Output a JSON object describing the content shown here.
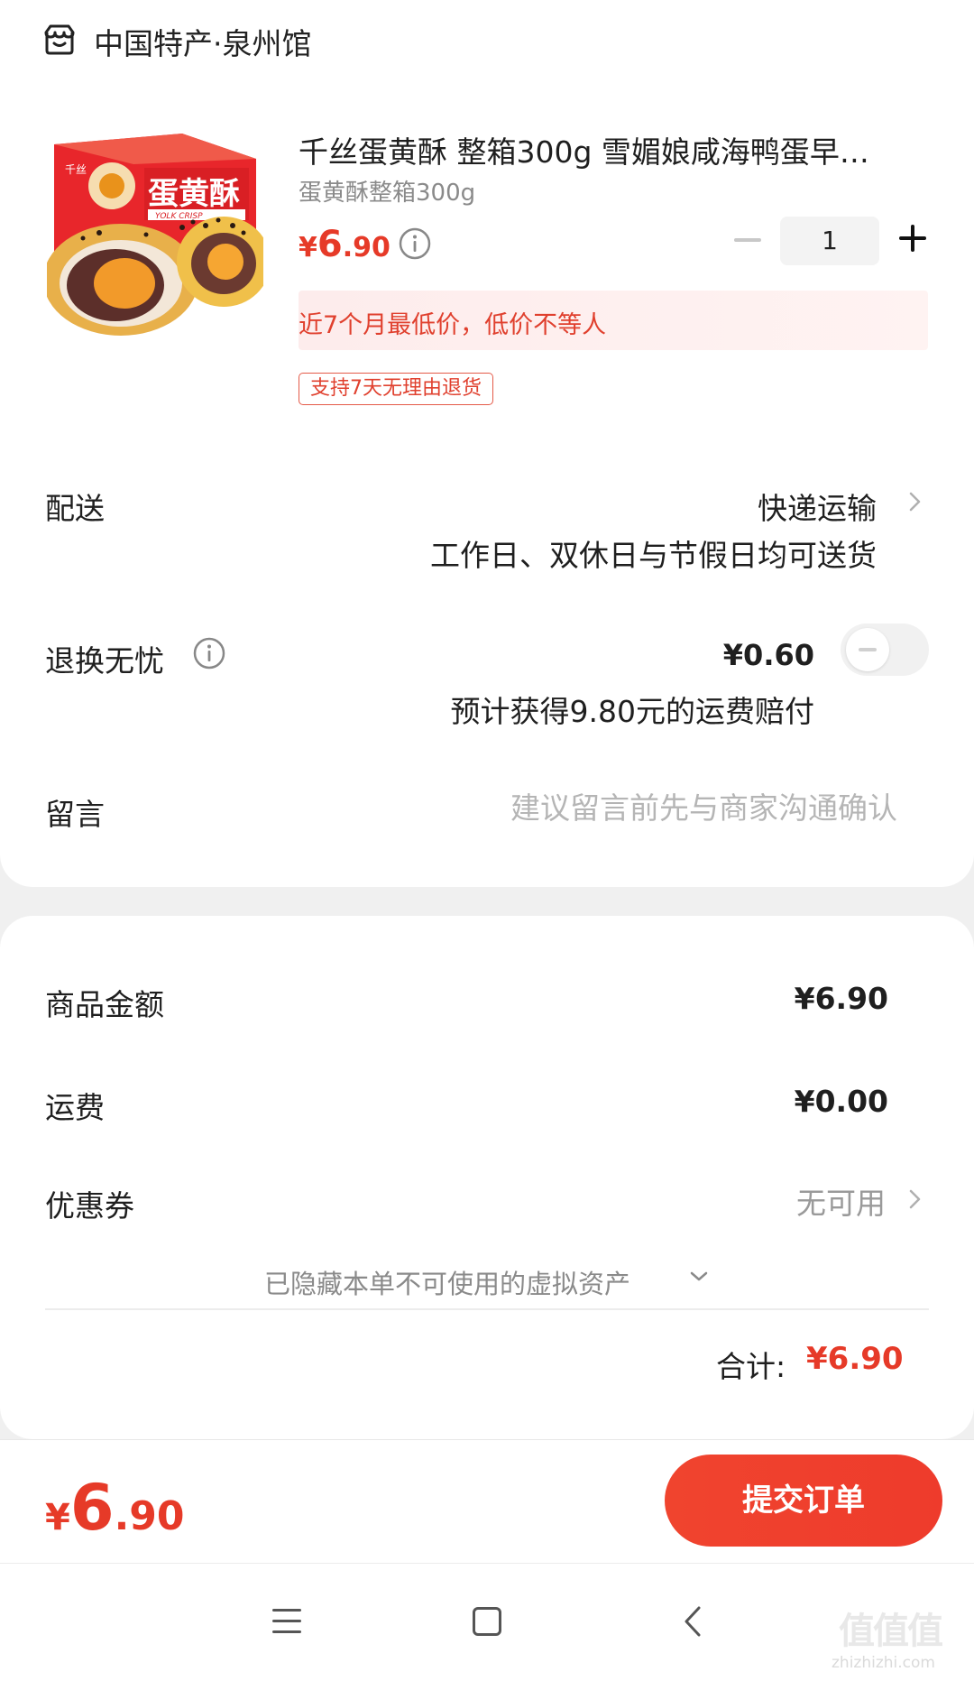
{
  "shop": {
    "name": "中国特产·泉州馆",
    "icon": "shop-icon"
  },
  "product": {
    "title": "千丝蛋黄酥 整箱300g 雪媚娘咸海鸭蛋早…",
    "spec": "蛋黄酥整箱300g",
    "price_symbol": "¥",
    "price_int": "6",
    "price_dec": ".90",
    "quantity": "1",
    "promo_text": "近7个月最低价，低价不等人",
    "return_badge": "支持7天无理由退货",
    "box_text": "蛋黄酥",
    "box_subtext": "YOLK CRISP",
    "brand_text": "千丝"
  },
  "delivery": {
    "label": "配送",
    "value": "快递运输",
    "note": "工作日、双休日与节假日均可送货"
  },
  "return_insurance": {
    "label": "退换无忧",
    "price": "¥0.60",
    "note": "预计获得9.80元的运费赔付",
    "enabled": false
  },
  "message": {
    "label": "留言",
    "placeholder": "建议留言前先与商家沟通确认"
  },
  "summary": {
    "goods_label": "商品金额",
    "goods_value": "¥6.90",
    "shipping_label": "运费",
    "shipping_value": "¥0.00",
    "coupon_label": "优惠券",
    "coupon_value": "无可用",
    "hidden_assets_note": "已隐藏本单不可使用的虚拟资产",
    "total_label": "合计:",
    "total_value": "¥6.90"
  },
  "bottom": {
    "price_symbol": "¥",
    "price_int": "6",
    "price_dec": ".90",
    "submit_label": "提交订单"
  },
  "watermark": {
    "text": "值值值",
    "url": "zhizhizhi.com"
  },
  "colors": {
    "accent": "#e63a28",
    "submit": "#ef4230",
    "promo_bg": "#fdecec",
    "muted": "#8a8a8a"
  }
}
